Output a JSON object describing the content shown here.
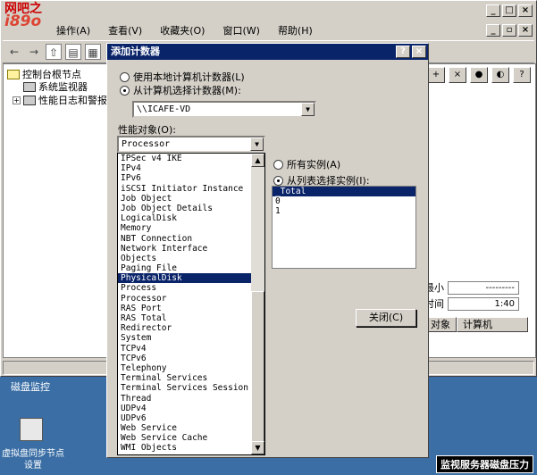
{
  "logo": {
    "line1": "网吧之",
    "line2": "i89o"
  },
  "mmc": {
    "menu": [
      "操作(A)",
      "查看(V)",
      "收藏夹(O)",
      "窗口(W)",
      "帮助(H)"
    ],
    "tree": {
      "root": "控制台根节点",
      "monitor": "系统监视器",
      "logs": "性能日志和警报"
    },
    "stats": {
      "min_label": "最小",
      "min_value": "---------",
      "time_label": "时间",
      "time_value": "1:40"
    },
    "columns": [
      "对象",
      "计算机"
    ]
  },
  "desktop": {
    "label": "磁盘监控",
    "icon_label": "虚拟盘同步节点设置",
    "banner": "监视服务器磁盘压力"
  },
  "dialog": {
    "title": "添加计数器",
    "radio_local": "使用本地计算机计数器(L)",
    "radio_select": "从计算机选择计数器(M):",
    "computer": "\\\\ICAFE-VD",
    "perf_object_label": "性能对象(O):",
    "perf_object_value": "Processor",
    "objects": [
      "IPSec v4 IKE",
      "IPv4",
      "IPv6",
      "iSCSI Initiator Instance",
      "Job Object",
      "Job Object Details",
      "LogicalDisk",
      "Memory",
      "NBT Connection",
      "Network Interface",
      "Objects",
      "Paging File",
      "PhysicalDisk",
      "Process",
      "Processor",
      "RAS Port",
      "RAS Total",
      "Redirector",
      "System",
      "TCPv4",
      "TCPv6",
      "Telephony",
      "Terminal Services",
      "Terminal Services Session",
      "Thread",
      "UDPv4",
      "UDPv6",
      "Web Service",
      "Web Service Cache",
      "WMI Objects"
    ],
    "selected_object": "PhysicalDisk",
    "radio_all_instances": "所有实例(A)",
    "radio_select_instances": "从列表选择实例(I):",
    "instances": [
      "_Total",
      "0",
      "1"
    ],
    "selected_instance": "_Total",
    "close_button": "关闭(C)"
  }
}
